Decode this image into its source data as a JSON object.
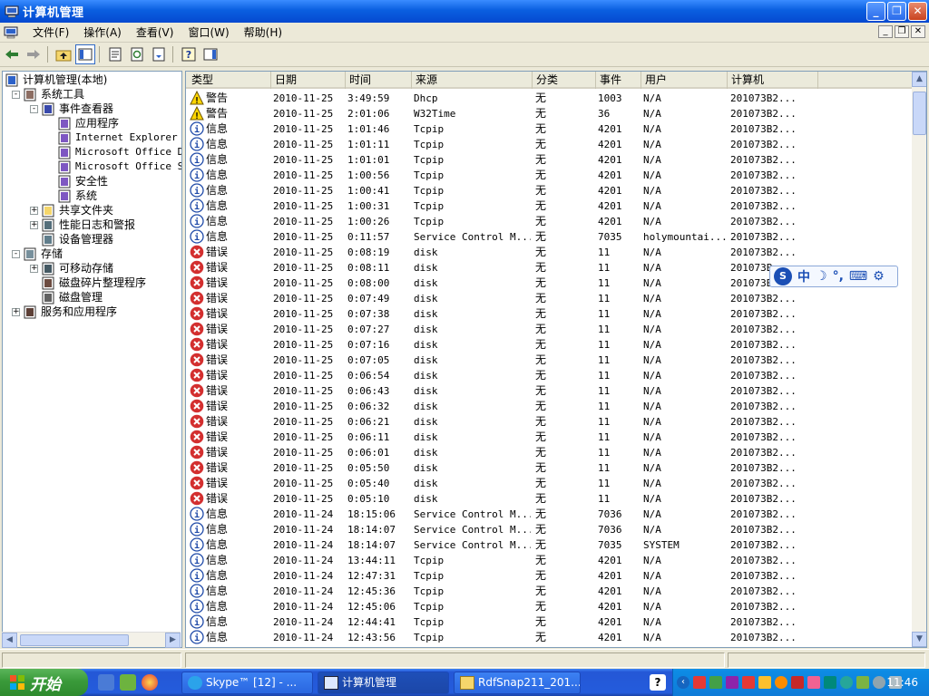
{
  "window": {
    "title": "计算机管理"
  },
  "menubar": [
    "文件(F)",
    "操作(A)",
    "查看(V)",
    "窗口(W)",
    "帮助(H)"
  ],
  "tree": [
    {
      "label": "计算机管理(本地)",
      "level": 0,
      "exp": "",
      "icon": "computer-icon"
    },
    {
      "label": "系统工具",
      "level": 1,
      "exp": "-",
      "icon": "tools-icon"
    },
    {
      "label": "事件查看器",
      "level": 2,
      "exp": "-",
      "icon": "event-viewer-icon"
    },
    {
      "label": "应用程序",
      "level": 3,
      "exp": "",
      "icon": "log-icon"
    },
    {
      "label": "Internet Explorer",
      "level": 3,
      "exp": "",
      "icon": "log-icon",
      "mono": true
    },
    {
      "label": "Microsoft Office Di",
      "level": 3,
      "exp": "",
      "icon": "log-icon",
      "mono": true
    },
    {
      "label": "Microsoft Office Se",
      "level": 3,
      "exp": "",
      "icon": "log-icon",
      "mono": true
    },
    {
      "label": "安全性",
      "level": 3,
      "exp": "",
      "icon": "security-log-icon"
    },
    {
      "label": "系统",
      "level": 3,
      "exp": "",
      "icon": "log-icon"
    },
    {
      "label": "共享文件夹",
      "level": 2,
      "exp": "+",
      "icon": "shared-folder-icon"
    },
    {
      "label": "性能日志和警报",
      "level": 2,
      "exp": "+",
      "icon": "performance-icon"
    },
    {
      "label": "设备管理器",
      "level": 2,
      "exp": "",
      "icon": "device-manager-icon"
    },
    {
      "label": "存储",
      "level": 1,
      "exp": "-",
      "icon": "storage-icon"
    },
    {
      "label": "可移动存储",
      "level": 2,
      "exp": "+",
      "icon": "removable-storage-icon"
    },
    {
      "label": "磁盘碎片整理程序",
      "level": 2,
      "exp": "",
      "icon": "defrag-icon"
    },
    {
      "label": "磁盘管理",
      "level": 2,
      "exp": "",
      "icon": "disk-management-icon"
    },
    {
      "label": "服务和应用程序",
      "level": 1,
      "exp": "+",
      "icon": "services-icon"
    }
  ],
  "columns": [
    "类型",
    "日期",
    "时间",
    "来源",
    "分类",
    "事件",
    "用户",
    "计算机"
  ],
  "events": [
    [
      "警告",
      "2010-11-25",
      "3:49:59",
      "Dhcp",
      "无",
      "1003",
      "N/A",
      "201073B2..."
    ],
    [
      "警告",
      "2010-11-25",
      "2:01:06",
      "W32Time",
      "无",
      "36",
      "N/A",
      "201073B2..."
    ],
    [
      "信息",
      "2010-11-25",
      "1:01:46",
      "Tcpip",
      "无",
      "4201",
      "N/A",
      "201073B2..."
    ],
    [
      "信息",
      "2010-11-25",
      "1:01:11",
      "Tcpip",
      "无",
      "4201",
      "N/A",
      "201073B2..."
    ],
    [
      "信息",
      "2010-11-25",
      "1:01:01",
      "Tcpip",
      "无",
      "4201",
      "N/A",
      "201073B2..."
    ],
    [
      "信息",
      "2010-11-25",
      "1:00:56",
      "Tcpip",
      "无",
      "4201",
      "N/A",
      "201073B2..."
    ],
    [
      "信息",
      "2010-11-25",
      "1:00:41",
      "Tcpip",
      "无",
      "4201",
      "N/A",
      "201073B2..."
    ],
    [
      "信息",
      "2010-11-25",
      "1:00:31",
      "Tcpip",
      "无",
      "4201",
      "N/A",
      "201073B2..."
    ],
    [
      "信息",
      "2010-11-25",
      "1:00:26",
      "Tcpip",
      "无",
      "4201",
      "N/A",
      "201073B2..."
    ],
    [
      "信息",
      "2010-11-25",
      "0:11:57",
      "Service Control M...",
      "无",
      "7035",
      "holymountai...",
      "201073B2..."
    ],
    [
      "错误",
      "2010-11-25",
      "0:08:19",
      "disk",
      "无",
      "11",
      "N/A",
      "201073B2..."
    ],
    [
      "错误",
      "2010-11-25",
      "0:08:11",
      "disk",
      "无",
      "11",
      "N/A",
      "201073B"
    ],
    [
      "错误",
      "2010-11-25",
      "0:08:00",
      "disk",
      "无",
      "11",
      "N/A",
      "201073B"
    ],
    [
      "错误",
      "2010-11-25",
      "0:07:49",
      "disk",
      "无",
      "11",
      "N/A",
      "201073B2..."
    ],
    [
      "错误",
      "2010-11-25",
      "0:07:38",
      "disk",
      "无",
      "11",
      "N/A",
      "201073B2..."
    ],
    [
      "错误",
      "2010-11-25",
      "0:07:27",
      "disk",
      "无",
      "11",
      "N/A",
      "201073B2..."
    ],
    [
      "错误",
      "2010-11-25",
      "0:07:16",
      "disk",
      "无",
      "11",
      "N/A",
      "201073B2..."
    ],
    [
      "错误",
      "2010-11-25",
      "0:07:05",
      "disk",
      "无",
      "11",
      "N/A",
      "201073B2..."
    ],
    [
      "错误",
      "2010-11-25",
      "0:06:54",
      "disk",
      "无",
      "11",
      "N/A",
      "201073B2..."
    ],
    [
      "错误",
      "2010-11-25",
      "0:06:43",
      "disk",
      "无",
      "11",
      "N/A",
      "201073B2..."
    ],
    [
      "错误",
      "2010-11-25",
      "0:06:32",
      "disk",
      "无",
      "11",
      "N/A",
      "201073B2..."
    ],
    [
      "错误",
      "2010-11-25",
      "0:06:21",
      "disk",
      "无",
      "11",
      "N/A",
      "201073B2..."
    ],
    [
      "错误",
      "2010-11-25",
      "0:06:11",
      "disk",
      "无",
      "11",
      "N/A",
      "201073B2..."
    ],
    [
      "错误",
      "2010-11-25",
      "0:06:01",
      "disk",
      "无",
      "11",
      "N/A",
      "201073B2..."
    ],
    [
      "错误",
      "2010-11-25",
      "0:05:50",
      "disk",
      "无",
      "11",
      "N/A",
      "201073B2..."
    ],
    [
      "错误",
      "2010-11-25",
      "0:05:40",
      "disk",
      "无",
      "11",
      "N/A",
      "201073B2..."
    ],
    [
      "错误",
      "2010-11-25",
      "0:05:10",
      "disk",
      "无",
      "11",
      "N/A",
      "201073B2..."
    ],
    [
      "信息",
      "2010-11-24",
      "18:15:06",
      "Service Control M...",
      "无",
      "7036",
      "N/A",
      "201073B2..."
    ],
    [
      "信息",
      "2010-11-24",
      "18:14:07",
      "Service Control M...",
      "无",
      "7036",
      "N/A",
      "201073B2..."
    ],
    [
      "信息",
      "2010-11-24",
      "18:14:07",
      "Service Control M...",
      "无",
      "7035",
      "SYSTEM",
      "201073B2..."
    ],
    [
      "信息",
      "2010-11-24",
      "13:44:11",
      "Tcpip",
      "无",
      "4201",
      "N/A",
      "201073B2..."
    ],
    [
      "信息",
      "2010-11-24",
      "12:47:31",
      "Tcpip",
      "无",
      "4201",
      "N/A",
      "201073B2..."
    ],
    [
      "信息",
      "2010-11-24",
      "12:45:36",
      "Tcpip",
      "无",
      "4201",
      "N/A",
      "201073B2..."
    ],
    [
      "信息",
      "2010-11-24",
      "12:45:06",
      "Tcpip",
      "无",
      "4201",
      "N/A",
      "201073B2..."
    ],
    [
      "信息",
      "2010-11-24",
      "12:44:41",
      "Tcpip",
      "无",
      "4201",
      "N/A",
      "201073B2..."
    ],
    [
      "信息",
      "2010-11-24",
      "12:43:56",
      "Tcpip",
      "无",
      "4201",
      "N/A",
      "201073B2..."
    ]
  ],
  "ime": {
    "label": "中"
  },
  "taskbar": {
    "start": "开始",
    "tasks": [
      "Skype™ [12] - ...",
      "计算机管理",
      "RdfSnap211_201..."
    ],
    "clock": "11:46"
  }
}
